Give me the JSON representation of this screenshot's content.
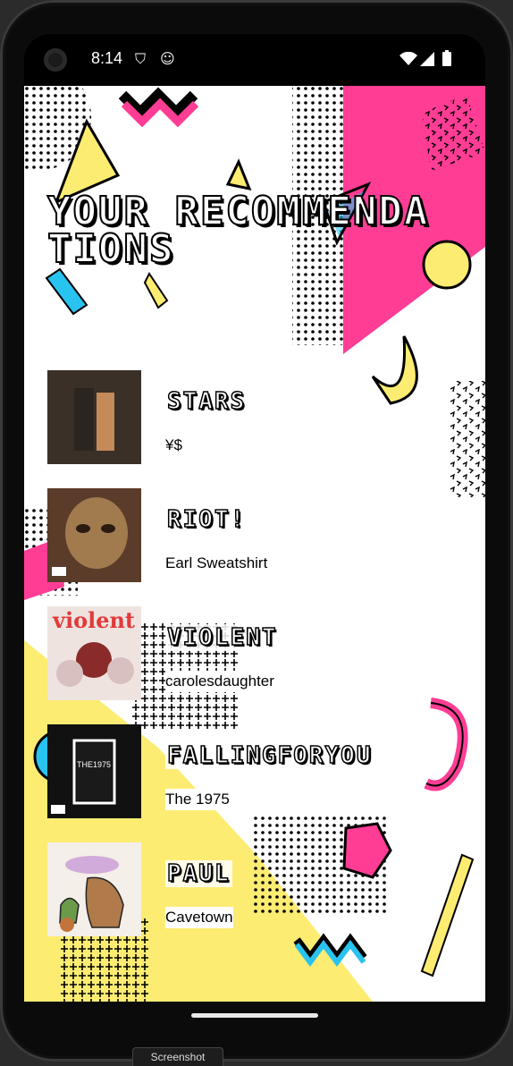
{
  "status_bar": {
    "time": "8:14",
    "icons": [
      "shield-icon",
      "cat-icon",
      "wifi-icon",
      "signal-icon",
      "battery-icon"
    ]
  },
  "page": {
    "title": "YOUR RECOMMENDATIONS"
  },
  "recommendations": [
    {
      "song": "STARS",
      "artist": "¥$",
      "cover_colors": [
        "#3a3027",
        "#c48a5a"
      ]
    },
    {
      "song": "RIOT!",
      "artist": "Earl Sweatshirt",
      "cover_colors": [
        "#5b3b2a",
        "#a17a4e"
      ]
    },
    {
      "song": "VIOLENT",
      "artist": "carolesdaughter",
      "cover_colors": [
        "#e23a3a",
        "#efe3e0"
      ]
    },
    {
      "song": "FALLINGFORYOU",
      "artist": "The 1975",
      "cover_colors": [
        "#111111",
        "#ffffff"
      ]
    },
    {
      "song": "PAUL",
      "artist": "Cavetown",
      "cover_colors": [
        "#f4efe8",
        "#b07a4a"
      ]
    }
  ],
  "overlay_label": "Screenshot",
  "colors": {
    "pink": "#ff3d95",
    "yellow": "#fdec72",
    "cyan": "#29c3f0",
    "black": "#000000"
  }
}
